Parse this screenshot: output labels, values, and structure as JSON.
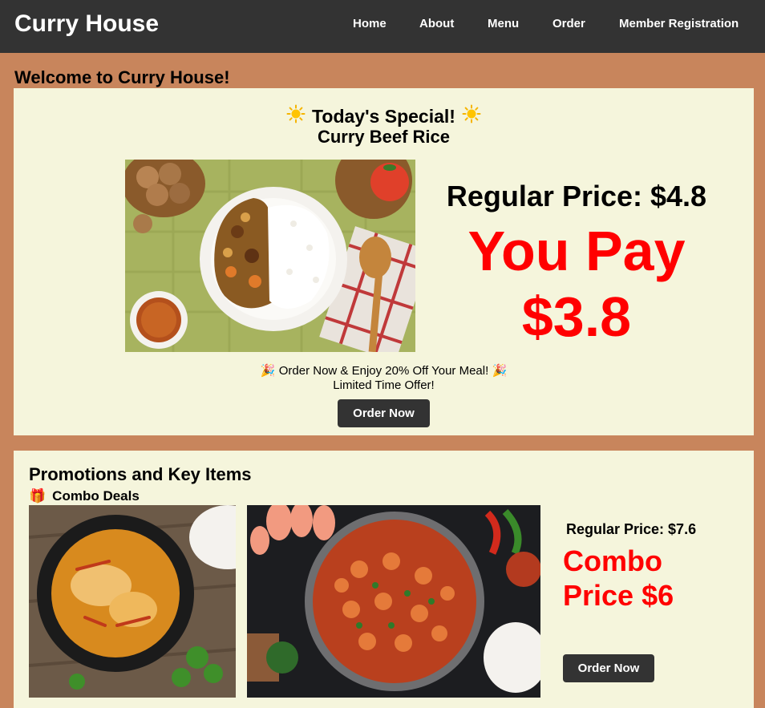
{
  "header": {
    "brand": "Curry House",
    "nav": [
      "Home",
      "About",
      "Menu",
      "Order",
      "Member Registration"
    ]
  },
  "welcome": "Welcome to Curry House!",
  "special": {
    "title": "Today's Special!",
    "title_icon": "sun-icon",
    "dish": "Curry Beef Rice",
    "regular_price": "Regular Price: $4.8",
    "you_pay": "You Pay $3.8",
    "offer_line": "Order Now & Enjoy 20% Off Your Meal!",
    "offer_icon": "party-popper-icon",
    "limited": "Limited Time Offer!",
    "button": "Order Now"
  },
  "promotions": {
    "title": "Promotions and Key Items",
    "combo_title": "Combo Deals",
    "combo_icon": "gift-icon",
    "regular_price": "Regular Price: $7.6",
    "combo_price": "Combo Price $6",
    "button": "Order Now"
  },
  "colors": {
    "header_bg": "#333333",
    "page_bg": "#c8855c",
    "panel_bg": "#f5f5dc",
    "accent_red": "#ff0000"
  }
}
